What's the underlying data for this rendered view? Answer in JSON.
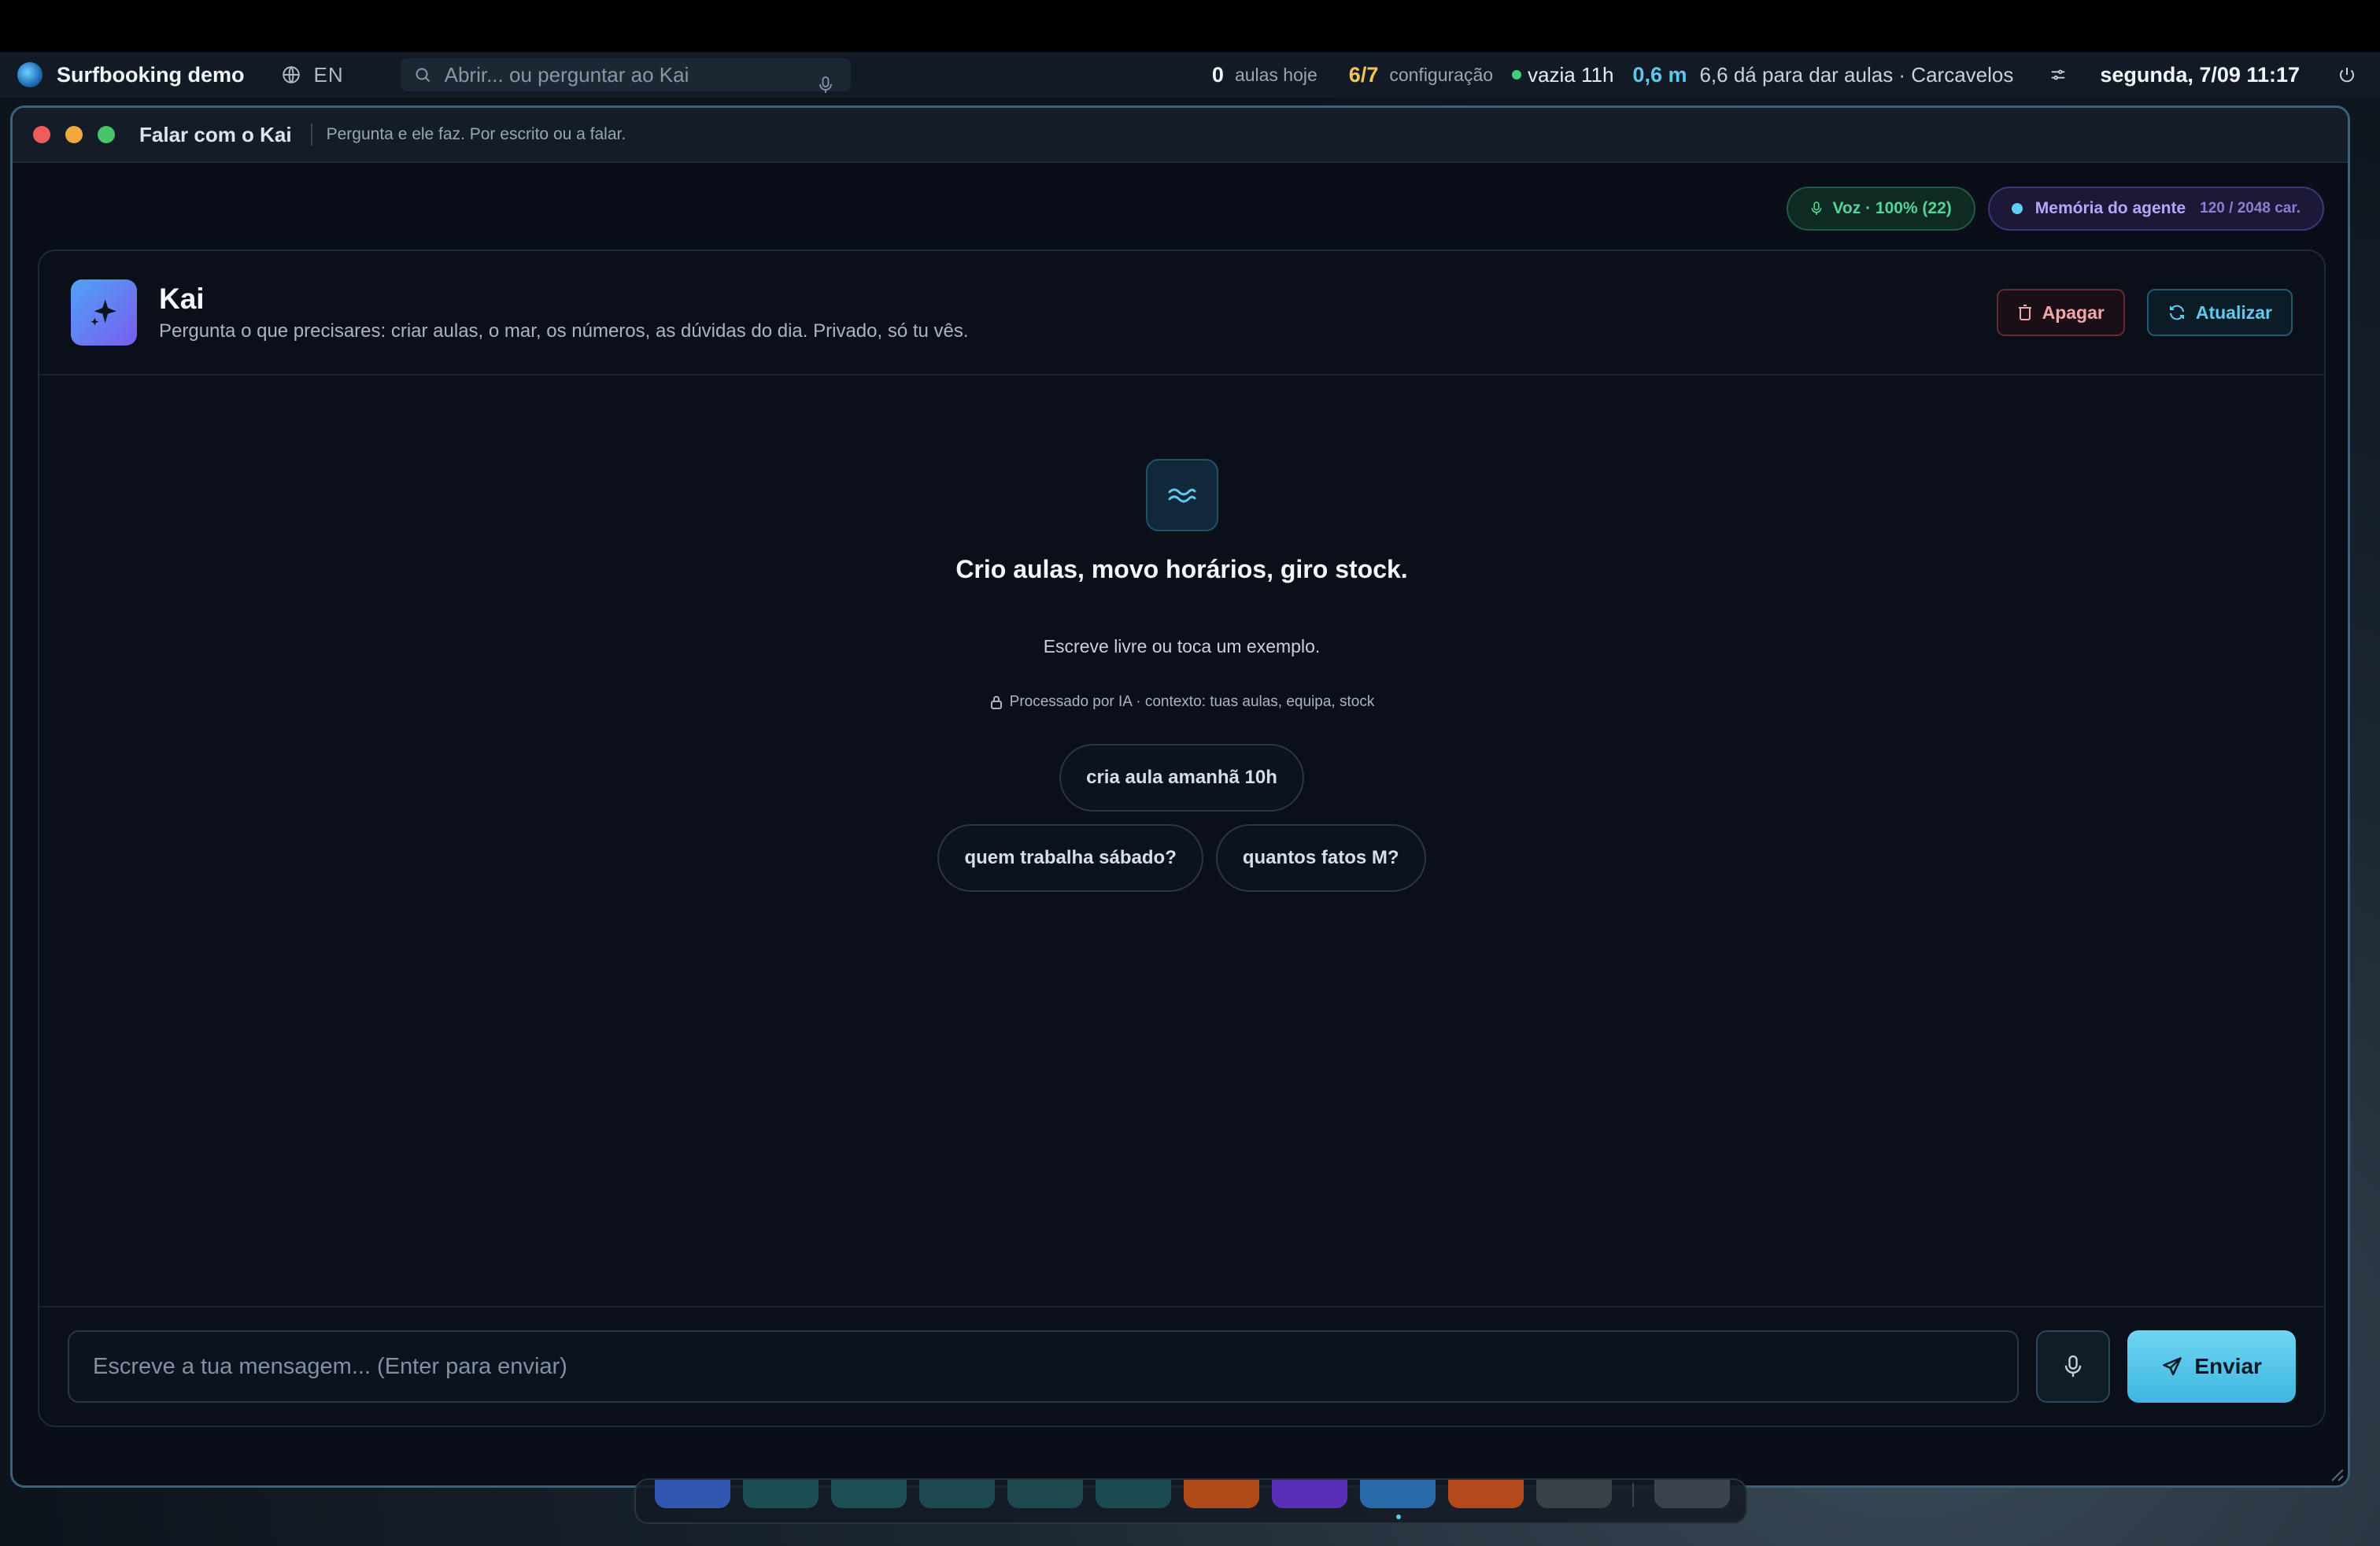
{
  "menubar": {
    "app_name": "Surfbooking demo",
    "language": "EN",
    "search_placeholder": "Abrir... ou perguntar ao Kai",
    "lessons_today_count": "0",
    "lessons_today_label": "aulas hoje",
    "config_progress": "6/7",
    "config_label": "configuração",
    "tide_status": "vazia 11h",
    "wave_height": "0,6 m",
    "surf_summary": "6,6 dá para dar aulas · Carcavelos",
    "datetime": "segunda, 7/09 11:17"
  },
  "window": {
    "title": "Falar com o Kai",
    "subtitle": "Pergunta e ele faz. Por escrito ou a falar."
  },
  "badges": {
    "voice": "Voz · 100% (22)",
    "memory_label": "Memória do agente",
    "memory_count": "120 / 2048 car."
  },
  "agent": {
    "name": "Kai",
    "description": "Pergunta o que precisares: criar aulas, o mar, os números, as dúvidas do dia. Privado, só tu vês.",
    "delete_label": "Apagar",
    "refresh_label": "Atualizar"
  },
  "empty_state": {
    "title": "Crio aulas, movo horários, giro stock.",
    "subtitle": "Escreve livre ou toca um exemplo.",
    "note": "Processado por IA · contexto: tuas aulas, equipa, stock",
    "suggestions": [
      "cria aula amanhã 10h",
      "quem trabalha sábado?",
      "quantos fatos M?"
    ]
  },
  "composer": {
    "placeholder": "Escreve a tua mensagem... (Enter para enviar)",
    "send_label": "Enviar"
  },
  "dock": {
    "colors": [
      "#2f57b0",
      "#1e4e55",
      "#1d4f54",
      "#1d4a50",
      "#1c484e",
      "#1c4a52",
      "#b04a18",
      "#5a2fb8",
      "#2b6aa8",
      "#b44a1c",
      "#3a4048",
      "#3c434c"
    ]
  },
  "colors": {
    "accent": "#5cc8f0",
    "voice_green": "#54d49a",
    "memory_purple": "#b9a6f7",
    "danger": "#f2a7a7",
    "config_yellow": "#f6c453"
  }
}
